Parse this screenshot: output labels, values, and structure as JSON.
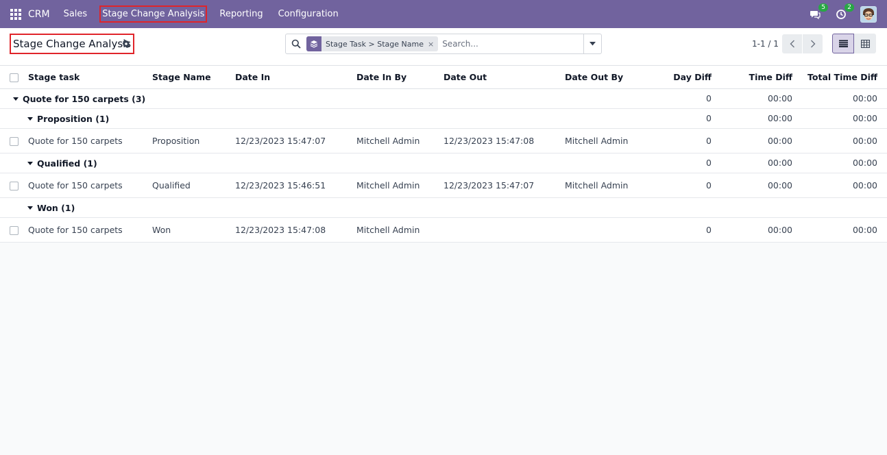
{
  "navbar": {
    "brand": "CRM",
    "menu": [
      {
        "label": "Sales",
        "active": false
      },
      {
        "label": "Stage Change Analysis",
        "active": true
      },
      {
        "label": "Reporting",
        "active": false
      },
      {
        "label": "Configuration",
        "active": false
      }
    ],
    "messages_count": "5",
    "activities_count": "2",
    "color": "#71639e"
  },
  "control_panel": {
    "title": "Stage Change Analysis",
    "search": {
      "facet_label": "Stage Task > Stage Name",
      "facet_remove": "×",
      "placeholder": "Search..."
    },
    "pager": "1-1 / 1"
  },
  "table": {
    "columns": [
      "Stage task",
      "Stage Name",
      "Date In",
      "Date In By",
      "Date Out",
      "Date Out By",
      "Day Diff",
      "Time Diff",
      "Total Time Diff"
    ],
    "rows": [
      {
        "type": "group",
        "level": 0,
        "label": "Quote for 150 carpets (3)",
        "day_diff": "0",
        "time_diff": "00:00",
        "total_time_diff": "00:00"
      },
      {
        "type": "group",
        "level": 1,
        "label": "Proposition (1)",
        "day_diff": "0",
        "time_diff": "00:00",
        "total_time_diff": "00:00"
      },
      {
        "type": "record",
        "stage_task": "Quote for 150 carpets",
        "stage_name": "Proposition",
        "date_in": "12/23/2023 15:47:07",
        "date_in_by": "Mitchell Admin",
        "date_out": "12/23/2023 15:47:08",
        "date_out_by": "Mitchell Admin",
        "day_diff": "0",
        "time_diff": "00:00",
        "total_time_diff": "00:00"
      },
      {
        "type": "group",
        "level": 1,
        "label": "Qualified (1)",
        "day_diff": "0",
        "time_diff": "00:00",
        "total_time_diff": "00:00"
      },
      {
        "type": "record",
        "stage_task": "Quote for 150 carpets",
        "stage_name": "Qualified",
        "date_in": "12/23/2023 15:46:51",
        "date_in_by": "Mitchell Admin",
        "date_out": "12/23/2023 15:47:07",
        "date_out_by": "Mitchell Admin",
        "day_diff": "0",
        "time_diff": "00:00",
        "total_time_diff": "00:00"
      },
      {
        "type": "group",
        "level": 1,
        "label": "Won (1)",
        "day_diff": "",
        "time_diff": "",
        "total_time_diff": ""
      },
      {
        "type": "record",
        "stage_task": "Quote for 150 carpets",
        "stage_name": "Won",
        "date_in": "12/23/2023 15:47:08",
        "date_in_by": "Mitchell Admin",
        "date_out": "",
        "date_out_by": "",
        "day_diff": "0",
        "time_diff": "00:00",
        "total_time_diff": "00:00"
      }
    ]
  }
}
